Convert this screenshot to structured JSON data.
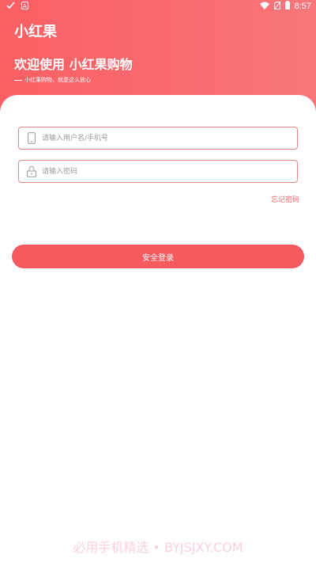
{
  "status_bar": {
    "time": "8:57"
  },
  "app": {
    "title": "小红果"
  },
  "hero": {
    "welcome": "欢迎使用 小红果购物",
    "slogan": "小红果购物，就是这么放心"
  },
  "login": {
    "username_placeholder": "请输入用户名/手机号",
    "password_placeholder": "请输入密码",
    "forgot_label": "忘记密码",
    "submit_label": "安全登录"
  },
  "watermark": "必用手机精选 • BYJSJXY.COM",
  "colors": {
    "brand": "#fa5f63",
    "button": "#f65a5f",
    "field_border": "#e58588"
  }
}
